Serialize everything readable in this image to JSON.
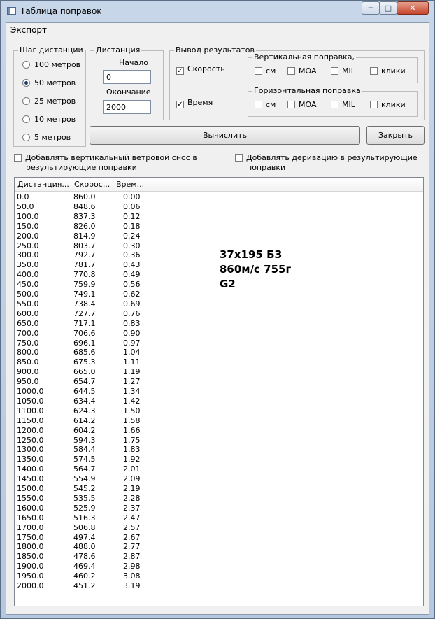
{
  "window": {
    "title": "Таблица поправок",
    "min_glyph": "─",
    "max_glyph": "□",
    "close_glyph": "✕"
  },
  "menu": {
    "export": "Экспорт"
  },
  "step_group": {
    "title": "Шаг дистанции",
    "options": [
      "100 метров",
      "50 метров",
      "25 метров",
      "10 метров",
      "5 метров"
    ],
    "selected": "50 метров"
  },
  "distance_group": {
    "title": "Дистанция",
    "start_label": "Начало",
    "start_value": "0",
    "end_label": "Окончание",
    "end_value": "2000"
  },
  "output_group": {
    "title": "Вывод результатов",
    "speed_label": "Скорость",
    "speed_checked": true,
    "time_label": "Время",
    "time_checked": true,
    "vertical": {
      "title": "Вертикальная поправка,",
      "units": [
        "см",
        "MOA",
        "MIL",
        "клики"
      ]
    },
    "horizontal": {
      "title": "Горизонтальная поправка",
      "units": [
        "см",
        "MOA",
        "MIL",
        "клики"
      ]
    }
  },
  "buttons": {
    "calculate": "Вычислить",
    "close": "Закрыть"
  },
  "options": {
    "wind_drift_line1": "Добавлять вертикальный ветровой снос в",
    "wind_drift_line2": "результирующие поправки",
    "derivation_line1": "Добавлять деривацию в результирующие",
    "derivation_line2": "поправки"
  },
  "table": {
    "columns": [
      "Дистанция...",
      "Скорос...",
      "Врем..."
    ],
    "rows": [
      [
        "0.0",
        "860.0",
        "0.00"
      ],
      [
        "50.0",
        "848.6",
        "0.06"
      ],
      [
        "100.0",
        "837.3",
        "0.12"
      ],
      [
        "150.0",
        "826.0",
        "0.18"
      ],
      [
        "200.0",
        "814.9",
        "0.24"
      ],
      [
        "250.0",
        "803.7",
        "0.30"
      ],
      [
        "300.0",
        "792.7",
        "0.36"
      ],
      [
        "350.0",
        "781.7",
        "0.43"
      ],
      [
        "400.0",
        "770.8",
        "0.49"
      ],
      [
        "450.0",
        "759.9",
        "0.56"
      ],
      [
        "500.0",
        "749.1",
        "0.62"
      ],
      [
        "550.0",
        "738.4",
        "0.69"
      ],
      [
        "600.0",
        "727.7",
        "0.76"
      ],
      [
        "650.0",
        "717.1",
        "0.83"
      ],
      [
        "700.0",
        "706.6",
        "0.90"
      ],
      [
        "750.0",
        "696.1",
        "0.97"
      ],
      [
        "800.0",
        "685.6",
        "1.04"
      ],
      [
        "850.0",
        "675.3",
        "1.11"
      ],
      [
        "900.0",
        "665.0",
        "1.19"
      ],
      [
        "950.0",
        "654.7",
        "1.27"
      ],
      [
        "1000.0",
        "644.5",
        "1.34"
      ],
      [
        "1050.0",
        "634.4",
        "1.42"
      ],
      [
        "1100.0",
        "624.3",
        "1.50"
      ],
      [
        "1150.0",
        "614.2",
        "1.58"
      ],
      [
        "1200.0",
        "604.2",
        "1.66"
      ],
      [
        "1250.0",
        "594.3",
        "1.75"
      ],
      [
        "1300.0",
        "584.4",
        "1.83"
      ],
      [
        "1350.0",
        "574.5",
        "1.92"
      ],
      [
        "1400.0",
        "564.7",
        "2.01"
      ],
      [
        "1450.0",
        "554.9",
        "2.09"
      ],
      [
        "1500.0",
        "545.2",
        "2.19"
      ],
      [
        "1550.0",
        "535.5",
        "2.28"
      ],
      [
        "1600.0",
        "525.9",
        "2.37"
      ],
      [
        "1650.0",
        "516.3",
        "2.47"
      ],
      [
        "1700.0",
        "506.8",
        "2.57"
      ],
      [
        "1750.0",
        "497.4",
        "2.67"
      ],
      [
        "1800.0",
        "488.0",
        "2.77"
      ],
      [
        "1850.0",
        "478.6",
        "2.87"
      ],
      [
        "1900.0",
        "469.4",
        "2.98"
      ],
      [
        "1950.0",
        "460.2",
        "3.08"
      ],
      [
        "2000.0",
        "451.2",
        "3.19"
      ]
    ]
  },
  "overlay_note": [
    "37x195 БЗ",
    "860м/с 755г",
    "G2"
  ]
}
